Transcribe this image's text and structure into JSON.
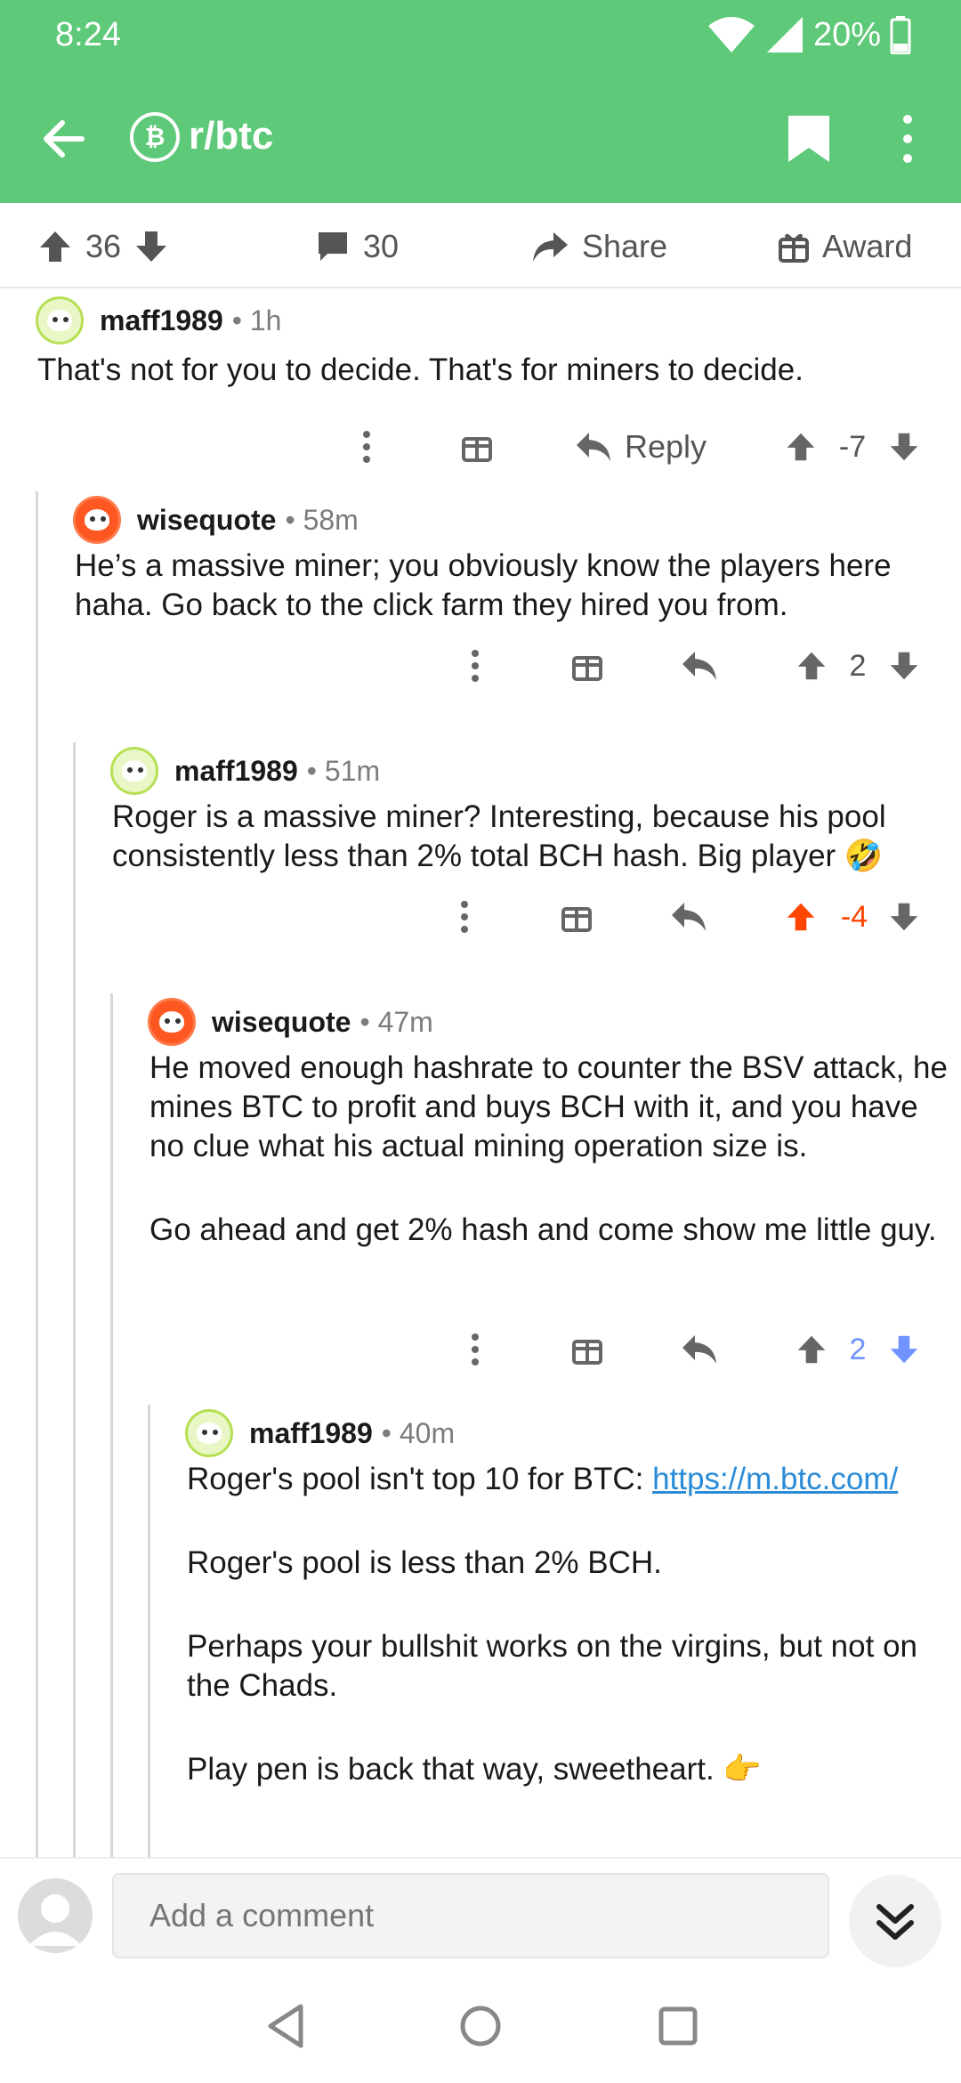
{
  "status_bar": {
    "time": "8:24",
    "battery": "20%"
  },
  "toolbar": {
    "subreddit": "r/btc",
    "subreddit_icon": "₿"
  },
  "post_bar": {
    "score": "36",
    "comments": "30",
    "share": "Share",
    "award": "Award"
  },
  "comments": [
    {
      "author": "maff1989",
      "time": "• 1h",
      "avatar": "green",
      "paragraphs": [
        "That's not for you to decide. That's for miners to decide."
      ],
      "reply_label": "Reply",
      "score": "-7",
      "vote_state": "none"
    },
    {
      "author": "wisequote",
      "time": "• 58m",
      "avatar": "orange",
      "paragraphs": [
        "He’s a massive miner; you obviously know the players here haha. Go back to the click farm they hired you from."
      ],
      "score": "2",
      "vote_state": "none"
    },
    {
      "author": "maff1989",
      "time": "• 51m",
      "avatar": "green",
      "paragraphs": [
        "Roger is a massive miner? Interesting, because his pool consistently less than 2% total BCH hash. Big player 🤣"
      ],
      "score": "-4",
      "vote_state": "up"
    },
    {
      "author": "wisequote",
      "time": "• 47m",
      "avatar": "orange",
      "paragraphs": [
        "He moved enough hashrate to counter the BSV attack, he mines BTC to profit and buys BCH with it, and you have no clue what his actual mining operation size is.",
        "Go ahead and get 2% hash and come show me little guy."
      ],
      "score": "2",
      "vote_state": "down"
    },
    {
      "author": "maff1989",
      "time": "• 40m",
      "avatar": "green",
      "link_prefix": "Roger's pool isn't top 10 for BTC: ",
      "link": "https://m.btc.com/",
      "paragraphs": [
        "Roger's pool is less than 2% BCH.",
        "Perhaps your bullshit works on the virgins, but not on the Chads.",
        "Play pen is back that way, sweetheart. 👉"
      ]
    }
  ],
  "composer": {
    "placeholder": "Add a comment"
  },
  "colors": {
    "header": "#5ec978",
    "upvote": "#ff4500",
    "downvote": "#7193ff",
    "neutral": "#555555",
    "link": "#2a8bd6"
  }
}
